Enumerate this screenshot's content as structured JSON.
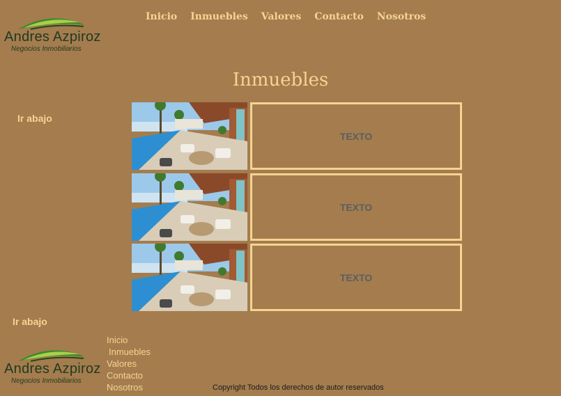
{
  "brand": {
    "name": "Andres Azpiroz",
    "tagline": "Negocios Inmobiliarios"
  },
  "nav": [
    {
      "label": "Inicio"
    },
    {
      "label": "Inmuebles"
    },
    {
      "label": "Valores"
    },
    {
      "label": "Contacto"
    },
    {
      "label": "Nosotros"
    }
  ],
  "page_title": "Inmuebles",
  "scroll_link_top": "Ir abajo",
  "scroll_link_bottom": "Ir abajo",
  "listings": [
    {
      "text": "TEXTO"
    },
    {
      "text": "TEXTO"
    },
    {
      "text": "TEXTO"
    }
  ],
  "footer": {
    "nav": [
      "Inicio",
      "Inmuebles",
      "Valores",
      "Contacto",
      "Nosotros"
    ],
    "copyright": "Copyright Todos los derechos de autor reservados"
  },
  "colors": {
    "background": "#a47c4e",
    "accent": "#f5d492",
    "box_text": "#5b5e62"
  }
}
